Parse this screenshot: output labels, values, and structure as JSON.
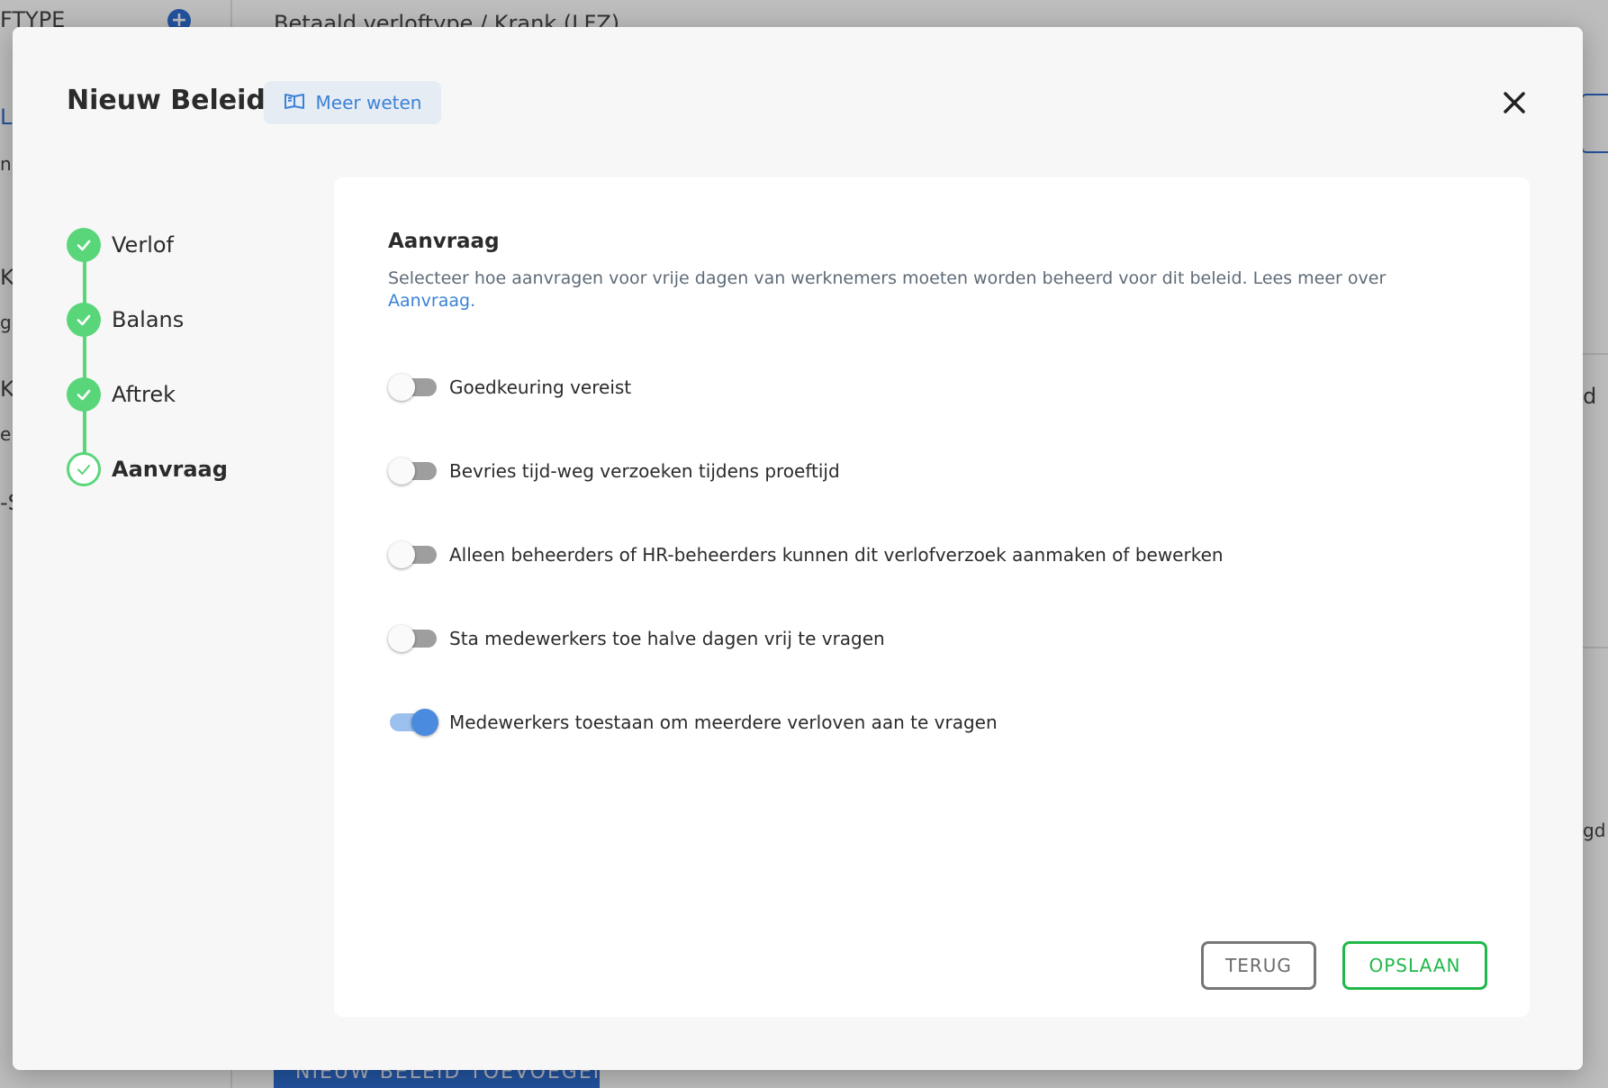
{
  "background": {
    "sidebar_heading": "FTYPE",
    "breadcrumb": "Betaald verloftype / Krank (LFZ)",
    "bottom_button": "NIEUW BELEID TOEVOEGEN",
    "left_fragments": [
      "LF",
      "n",
      "K",
      "g",
      "KE",
      "er",
      "-S"
    ],
    "right_fragments": [
      "d",
      "gd"
    ]
  },
  "modal": {
    "title": "Nieuw Beleid",
    "learn_more": "Meer weten",
    "close_icon": "close-icon"
  },
  "stepper": {
    "steps": [
      {
        "label": "Verlof",
        "status": "done"
      },
      {
        "label": "Balans",
        "status": "done"
      },
      {
        "label": "Aftrek",
        "status": "done"
      },
      {
        "label": "Aanvraag",
        "status": "current"
      }
    ]
  },
  "panel": {
    "title": "Aanvraag",
    "description": "Selecteer hoe aanvragen voor vrije dagen van werknemers moeten worden beheerd voor dit beleid. Lees meer over",
    "description_link": "Aanvraag.",
    "toggles": [
      {
        "label": "Goedkeuring vereist",
        "on": false
      },
      {
        "label": "Bevries tijd-weg verzoeken tijdens proeftijd",
        "on": false
      },
      {
        "label": "Alleen beheerders of HR-beheerders kunnen dit verlofverzoek aanmaken of bewerken",
        "on": false
      },
      {
        "label": "Sta medewerkers toe halve dagen vrij te vragen",
        "on": false
      },
      {
        "label": "Medewerkers toestaan om meerdere verloven aan te vragen",
        "on": true
      }
    ],
    "back_button": "TERUG",
    "save_button": "OPSLAAN"
  },
  "colors": {
    "accent_blue": "#3b82d6",
    "step_green": "#5ad67a",
    "save_green": "#21b84a"
  }
}
